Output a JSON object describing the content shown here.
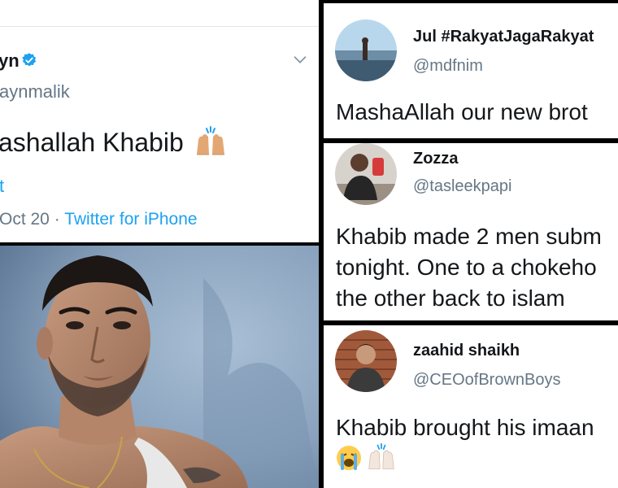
{
  "main_tweet": {
    "name_partial": "yn",
    "handle_partial": "aynmalik",
    "text_partial": "ashallah Khabib",
    "translate_partial": "t",
    "meta_time_partial": "Oct 20",
    "meta_separator": "·",
    "meta_source": "Twitter for iPhone",
    "icons": [
      "verified-badge-icon",
      "chevron-down-icon",
      "raised-hands-emoji"
    ]
  },
  "tweets": [
    {
      "name": "Jul #RakyatJagaRakyat",
      "handle": "@mdfnim",
      "text": "MashaAllah our new brot"
    },
    {
      "name": "Zozza",
      "handle": "@tasleekpapi",
      "lines": [
        "Khabib made 2 men subm",
        "tonight. One to a chokeho",
        "the other back to islam"
      ]
    },
    {
      "name": "zaahid shaikh",
      "handle": "@CEOofBrownBoys",
      "text": "Khabib brought his imaan",
      "emojis": [
        "loudly-crying-face-emoji",
        "raised-hands-emoji"
      ]
    }
  ],
  "colors": {
    "link_blue": "#1da1f2",
    "handle_gray": "#657786",
    "text_dark": "#14171a",
    "border": "#000000"
  }
}
